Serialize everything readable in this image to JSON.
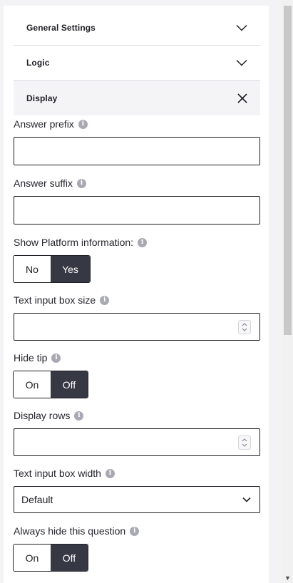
{
  "sections": [
    {
      "label": "General Settings",
      "state": "collapsed"
    },
    {
      "label": "Logic",
      "state": "collapsed"
    },
    {
      "label": "Display",
      "state": "expanded"
    }
  ],
  "fields": {
    "answer_prefix": {
      "label": "Answer prefix",
      "value": ""
    },
    "answer_suffix": {
      "label": "Answer suffix",
      "value": ""
    },
    "show_platform_info": {
      "label": "Show Platform information:",
      "options": [
        "No",
        "Yes"
      ],
      "selected": "Yes"
    },
    "text_input_box_size": {
      "label": "Text input box size",
      "value": ""
    },
    "hide_tip": {
      "label": "Hide tip",
      "options": [
        "On",
        "Off"
      ],
      "selected": "Off"
    },
    "display_rows": {
      "label": "Display rows",
      "value": ""
    },
    "text_input_box_width": {
      "label": "Text input box width",
      "selected": "Default"
    },
    "always_hide": {
      "label": "Always hide this question",
      "options": [
        "On",
        "Off"
      ],
      "selected": "Off"
    }
  },
  "icons": {
    "info": "info-icon",
    "collapsed": "chevron-down-icon",
    "expanded": "close-icon"
  },
  "colors": {
    "selected_toggle": "#363844",
    "border": "#1f1f26",
    "info_icon": "#a9a9b3"
  }
}
